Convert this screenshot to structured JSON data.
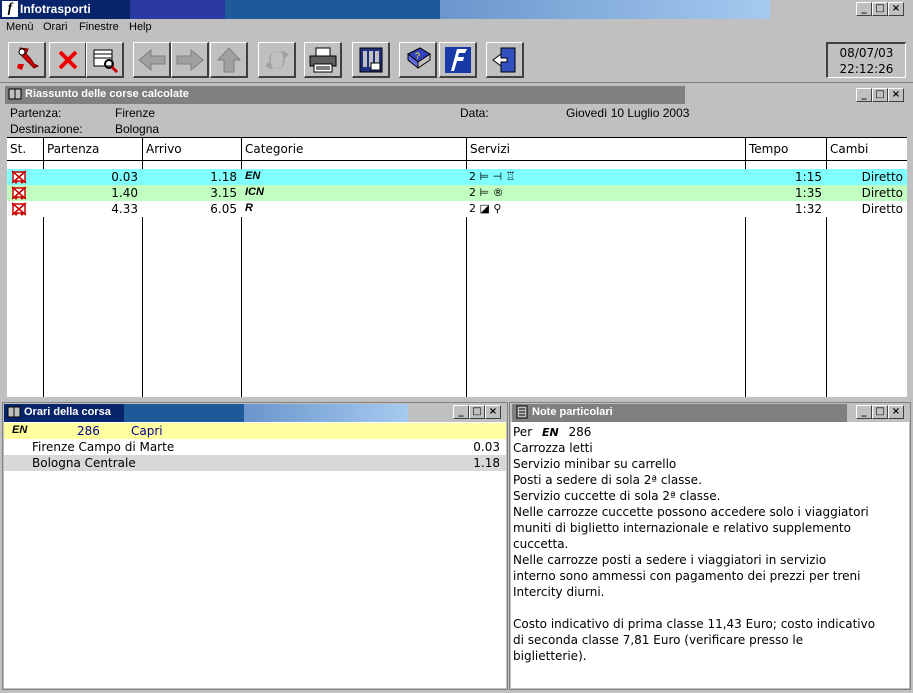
{
  "app": {
    "title": "Infotrasporti"
  },
  "menu": [
    "Menù",
    "Orari",
    "Finestre",
    "Help"
  ],
  "toolbar": {
    "icons": [
      "italy-map-icon",
      "close-x-icon",
      "search-book-icon",
      "back-arrow-icon",
      "forward-arrow-icon",
      "up-arrow-icon",
      "refresh-icon",
      "printer-icon",
      "calculator-icon",
      "help-book-icon",
      "fs-logo-icon",
      "exit-door-icon"
    ]
  },
  "clock": {
    "date": "08/07/03",
    "time": "22:12:26"
  },
  "summary": {
    "window_title": "Riassunto delle corse calcolate",
    "partenza_label": "Partenza:",
    "partenza_value": "Firenze",
    "destinazione_label": "Destinazione:",
    "destinazione_value": "Bologna",
    "data_label": "Data:",
    "data_value": "Giovedì 10 Luglio 2003",
    "columns": [
      "St.",
      "Partenza",
      "Arrivo",
      "Categorie",
      "Servizi",
      "Tempo",
      "Cambi"
    ],
    "rows": [
      {
        "partenza": "0.03",
        "arrivo": "1.18",
        "categoria": "EN",
        "servizi": "2 ⊨ ⊣ ♖",
        "tempo": "1:15",
        "cambi": "Diretto",
        "bg": "#80ffff"
      },
      {
        "partenza": "1.40",
        "arrivo": "3.15",
        "categoria": "ICN",
        "servizi": "2 ⊨ ®",
        "tempo": "1:35",
        "cambi": "Diretto",
        "bg": "#c0ffc0"
      },
      {
        "partenza": "4.33",
        "arrivo": "6.05",
        "categoria": "R",
        "servizi": "2 ◪ ⚲",
        "tempo": "1:32",
        "cambi": "Diretto",
        "bg": "#ffffff"
      }
    ]
  },
  "orari": {
    "window_title": "Orari della corsa",
    "train_cat": "EN",
    "train_number": "286",
    "train_name": "Capri",
    "stops": [
      {
        "name": "Firenze Campo di Marte",
        "time": "0.03"
      },
      {
        "name": "Bologna Centrale",
        "time": "1.18"
      }
    ]
  },
  "note": {
    "window_title": "Note particolari",
    "per_label": "Per",
    "per_cat": "EN",
    "per_number": "286",
    "lines": [
      "Carrozza letti",
      "Servizio minibar su carrello",
      "Posti a sedere di sola 2ª classe.",
      "Servizio cuccette di sola 2ª classe.",
      "Nelle carrozze cuccette possono accedere solo i viaggiatori",
      "muniti di biglietto internazionale e relativo supplemento",
      "cuccetta.",
      "Nelle carrozze posti a sedere i viaggiatori in servizio",
      "interno sono ammessi con pagamento dei prezzi per treni",
      "Intercity diurni.",
      "",
      "Costo indicativo di prima classe 11,43 Euro; costo indicativo",
      "di seconda classe 7,81 Euro (verificare presso le",
      "biglietterie)."
    ]
  },
  "window_buttons": {
    "min": "_",
    "max": "□",
    "close": "×"
  }
}
